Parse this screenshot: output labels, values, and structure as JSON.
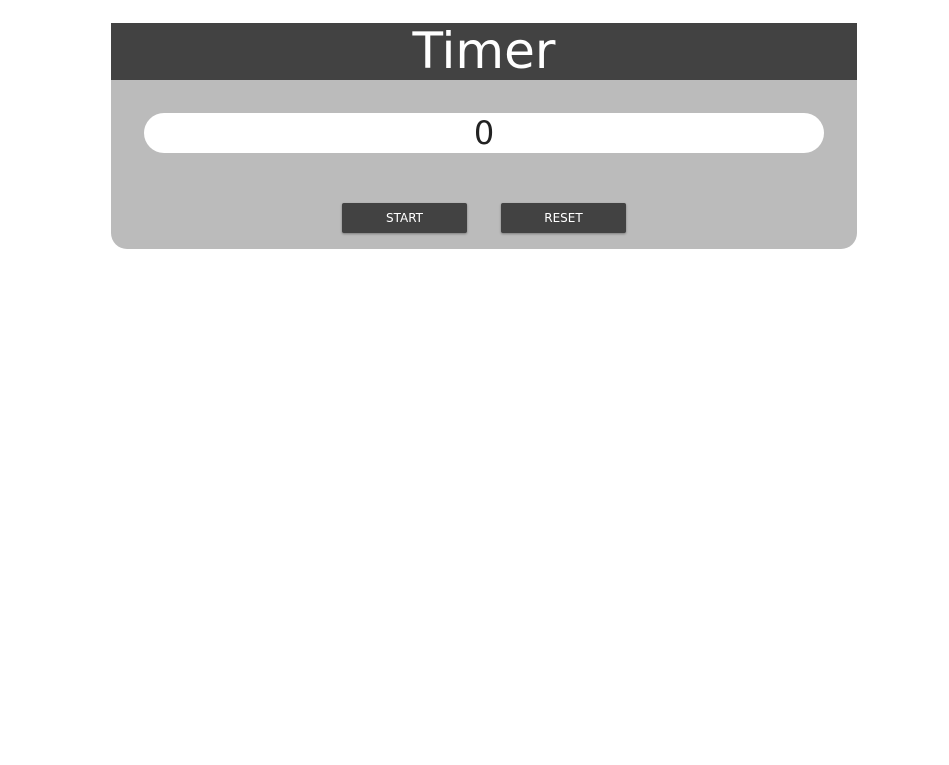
{
  "timer": {
    "title": "Timer",
    "display_value": "0",
    "start_label": "START",
    "reset_label": "RESET"
  },
  "colors": {
    "header_bg": "#424242",
    "card_bg": "#bbbbbb",
    "display_bg": "#ffffff",
    "button_bg": "#424242",
    "button_text": "#ffffff"
  }
}
